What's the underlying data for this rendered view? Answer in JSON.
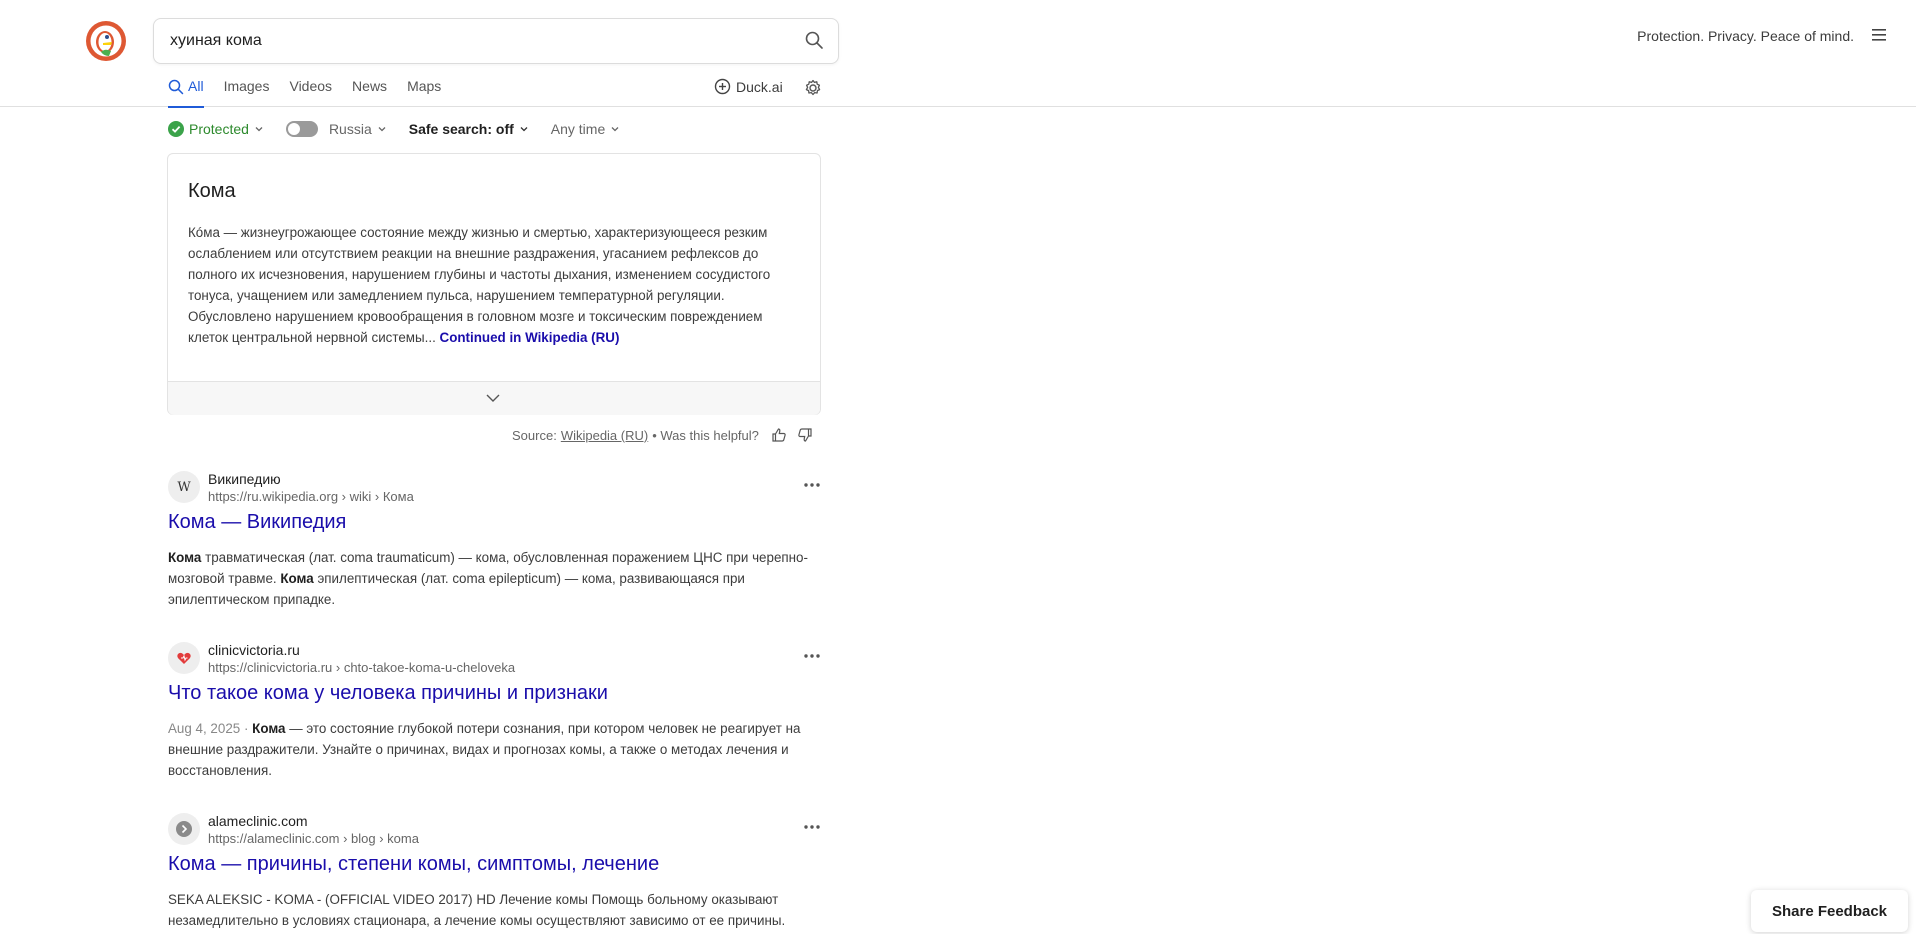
{
  "search": {
    "query": "хуиная кома"
  },
  "header": {
    "tagline": "Protection. Privacy. Peace of mind.",
    "logo_icon": "duckduckgo-logo",
    "menu_icon": "hamburger-menu-icon"
  },
  "tabs": [
    {
      "label": "All",
      "active": true
    },
    {
      "label": "Images"
    },
    {
      "label": "Videos"
    },
    {
      "label": "News"
    },
    {
      "label": "Maps"
    }
  ],
  "duck_ai": {
    "label": "Duck.ai"
  },
  "filters": {
    "protected": "Protected",
    "region": "Russia",
    "safe_search": "Safe search: off",
    "time": "Any time"
  },
  "knowledge_panel": {
    "title": "Кома",
    "text": "Кóма — жизнеугрожающее состояние между жизнью и смертью, характеризующееся резким ослаблением или отсутствием реакции на внешние раздражения, угасанием рефлексов до полного их исчезновения, нарушением глубины и частоты дыхания, изменением сосудистого тонуса, учащением или замедлением пульса, нарушением температурной регуляции. Обусловлено нарушением кровообращения в головном мозге и токсическим повреждением клеток центральной нервной системы...",
    "more_link": "Continued in Wikipedia (RU)"
  },
  "source": {
    "prefix": "Source:",
    "link": "Wikipedia (RU)",
    "suffix": "• Was this helpful?"
  },
  "results": [
    {
      "favicon": "W",
      "site": "Википедию",
      "url": "https://ru.wikipedia.org › wiki › Кома",
      "title": "Кома — Википедия",
      "snippet_parts": [
        {
          "b": "Кома"
        },
        {
          "t": " травматическая (лат. coma traumaticum) — кома, обусловленная поражением ЦНС при черепно-мозговой травме. "
        },
        {
          "b": "Кома"
        },
        {
          "t": " эпилептическая (лат. coma epilepticum) — кома, развивающаяся при эпилептическом припадке."
        }
      ]
    },
    {
      "favicon": "",
      "site": "clinicvictoria.ru",
      "url": "https://clinicvictoria.ru › chto-takoe-koma-u-cheloveka",
      "title": "Что такое кома у человека причины и признаки",
      "date": "Aug 4, 2025",
      "snippet_parts": [
        {
          "b": "Кома"
        },
        {
          "t": " — это состояние глубокой потери сознания, при котором человек не реагирует на внешние раздражители. Узнайте о причинах, видах и прогнозах комы, а также о методах лечения и восстановления."
        }
      ]
    },
    {
      "favicon": "",
      "site": "alameclinic.com",
      "url": "https://alameclinic.com › blog › koma",
      "title": "Кома — причины, степени комы, симптомы, лечение",
      "snippet_parts": [
        {
          "t": "SEKA ALEKSIC - KOMA - (OFFICIAL VIDEO 2017) HD Лечение комы Помощь больному оказывают незамедлительно в условиях стационара, а лечение комы осуществляют зависимо от ее причины."
        }
      ]
    }
  ],
  "share_feedback": "Share Feedback",
  "colors": {
    "link": "#1a0dab",
    "accent": "#1f5bd8",
    "protected": "#2d8a2d"
  }
}
